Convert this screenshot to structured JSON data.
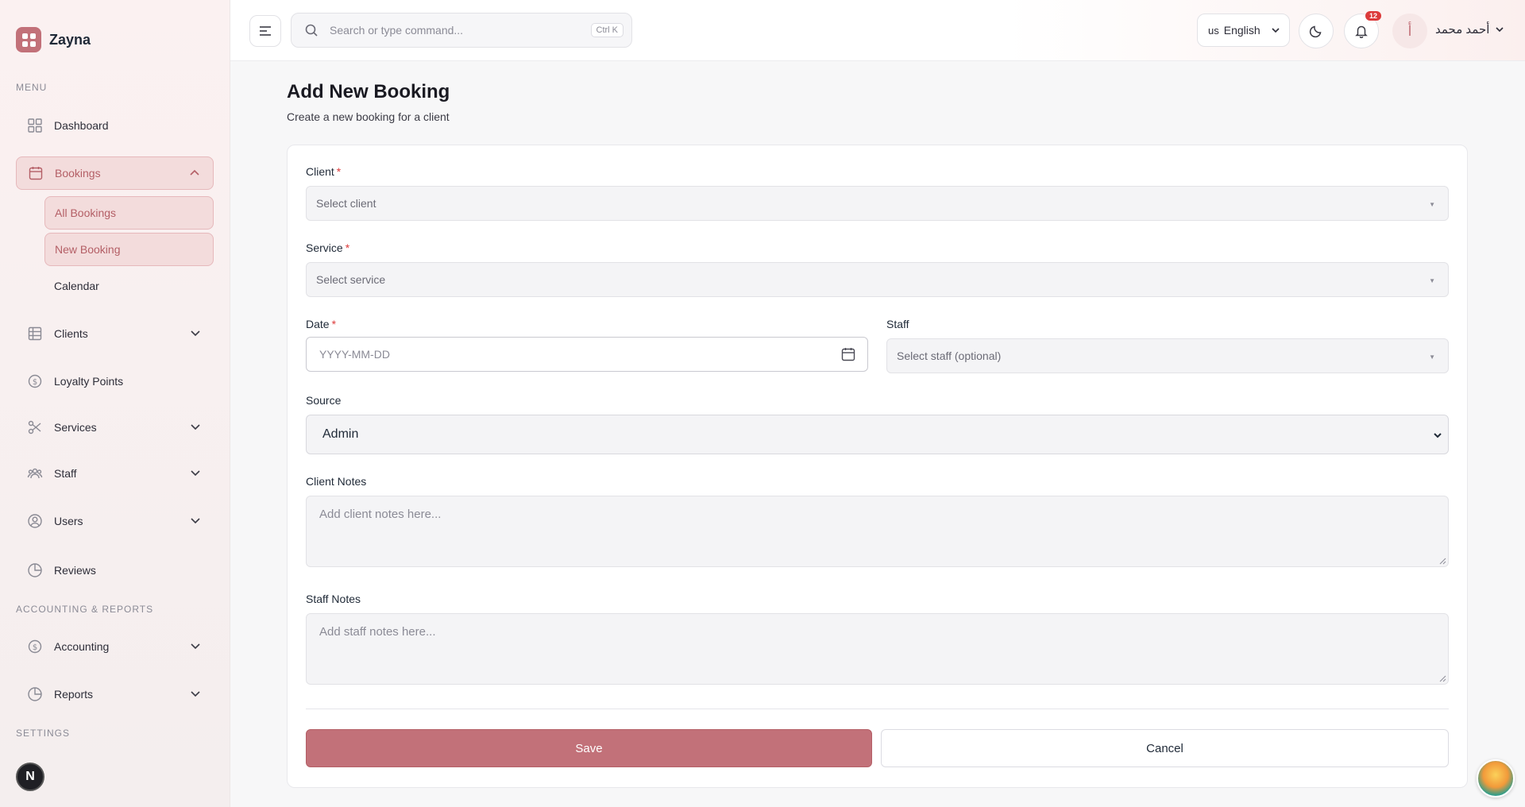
{
  "brand": {
    "name": "Zayna"
  },
  "sidebar": {
    "menu_label": "MENU",
    "accounting_label": "ACCOUNTING & REPORTS",
    "settings_label": "SETTINGS",
    "items": {
      "dashboard": "Dashboard",
      "bookings": "Bookings",
      "all_bookings": "All Bookings",
      "new_booking": "New Booking",
      "calendar": "Calendar",
      "clients": "Clients",
      "loyalty": "Loyalty Points",
      "services": "Services",
      "staff": "Staff",
      "users": "Users",
      "reviews": "Reviews",
      "accounting": "Accounting",
      "reports": "Reports"
    },
    "footer_badge": "N"
  },
  "header": {
    "search_placeholder": "Search or type command...",
    "search_shortcut": "Ctrl K",
    "lang_code": "us",
    "lang_label": "English",
    "notif_count": "12",
    "avatar_letter": "أ",
    "user_name": "أحمد محمد"
  },
  "page": {
    "title": "Add New Booking",
    "subtitle": "Create a new booking for a client"
  },
  "form": {
    "client_label": "Client",
    "client_placeholder": "Select client",
    "service_label": "Service",
    "service_placeholder": "Select service",
    "date_label": "Date",
    "date_placeholder": "YYYY-MM-DD",
    "staff_label": "Staff",
    "staff_placeholder": "Select staff (optional)",
    "source_label": "Source",
    "source_value": "Admin",
    "client_notes_label": "Client Notes",
    "client_notes_placeholder": "Add client notes here...",
    "staff_notes_label": "Staff Notes",
    "staff_notes_placeholder": "Add staff notes here...",
    "required_mark": "*",
    "save_label": "Save",
    "cancel_label": "Cancel"
  },
  "colors": {
    "accent": "#c27179",
    "accent_light": "#f3dcdc",
    "danger": "#dc3b3b"
  }
}
